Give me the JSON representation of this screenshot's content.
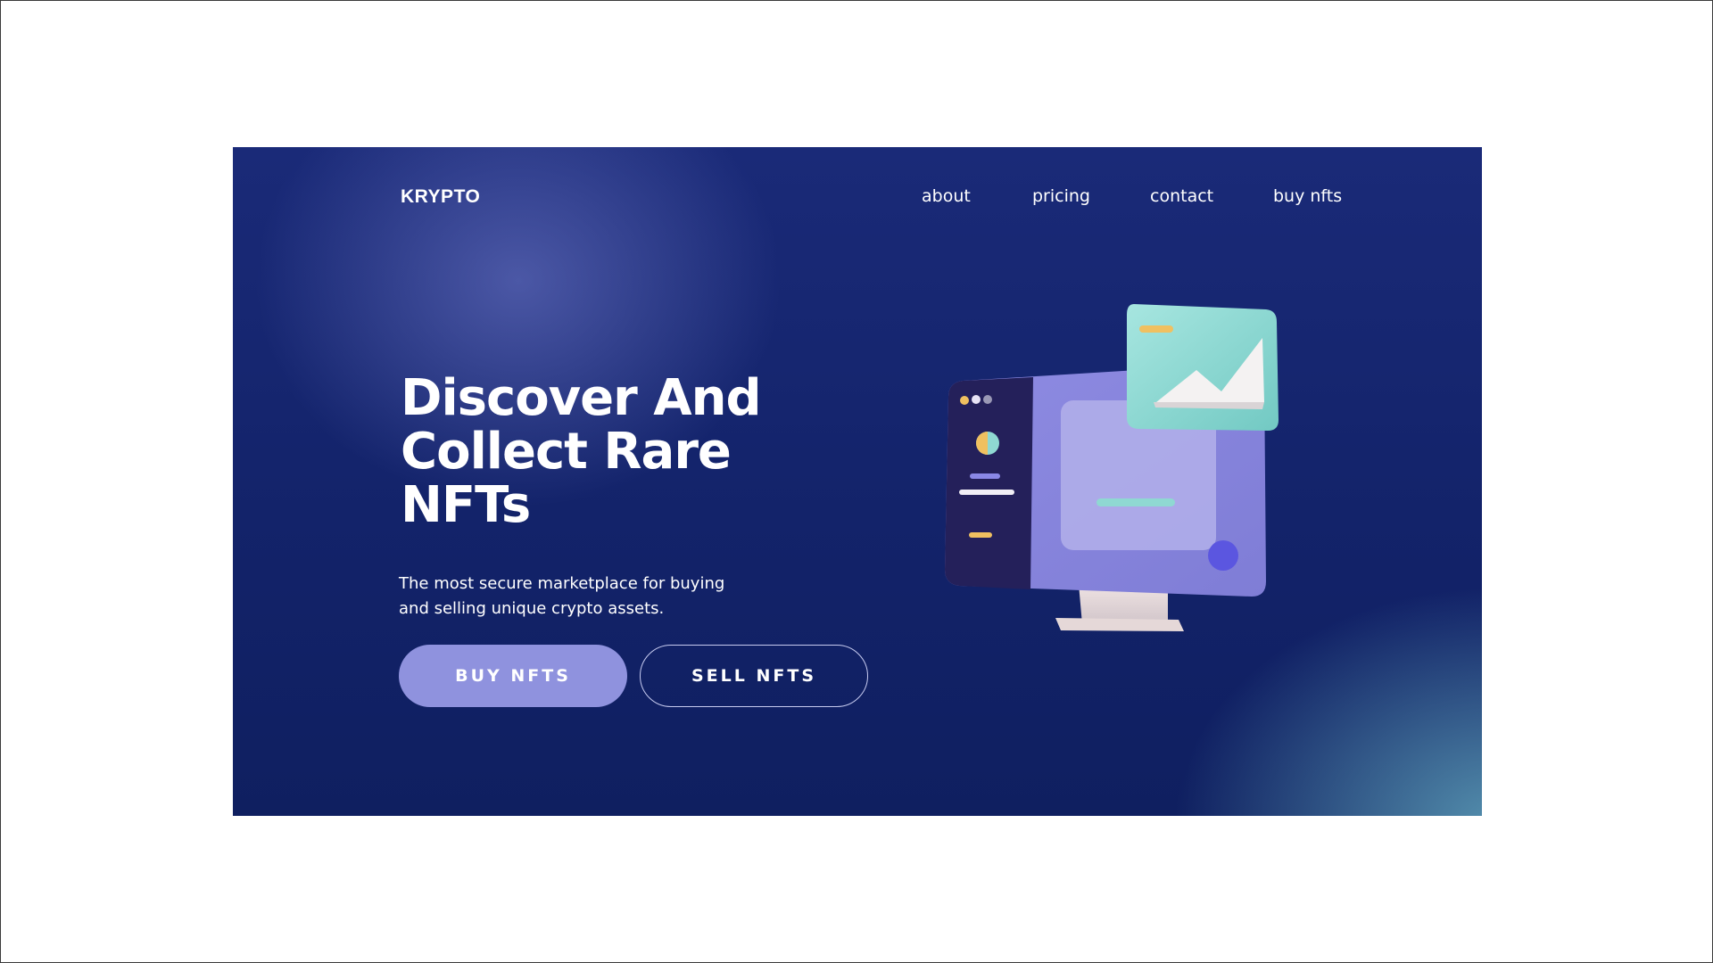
{
  "brand": {
    "logo": "KRYPTO"
  },
  "nav": {
    "items": [
      {
        "label": "about"
      },
      {
        "label": "pricing"
      },
      {
        "label": "contact"
      },
      {
        "label": "buy nfts"
      }
    ]
  },
  "hero": {
    "headline_line1": "Discover And",
    "headline_line2": "Collect Rare",
    "headline_line3": "NFTs",
    "subtext_line1": "The most secure marketplace for buying",
    "subtext_line2": "and selling unique crypto assets.",
    "primary_button": "BUY NFTS",
    "secondary_button": "SELL NFTS"
  },
  "colors": {
    "background_dark": "#13236a",
    "background_light": "#5896b2",
    "primary_button": "#8f92de",
    "text": "#ffffff",
    "illustration_monitor": "#8a88de",
    "illustration_sidebar": "#25205a",
    "illustration_card": "#8fd8d2"
  },
  "illustration": {
    "icon": "computer-monitor-with-image-card-icon"
  }
}
